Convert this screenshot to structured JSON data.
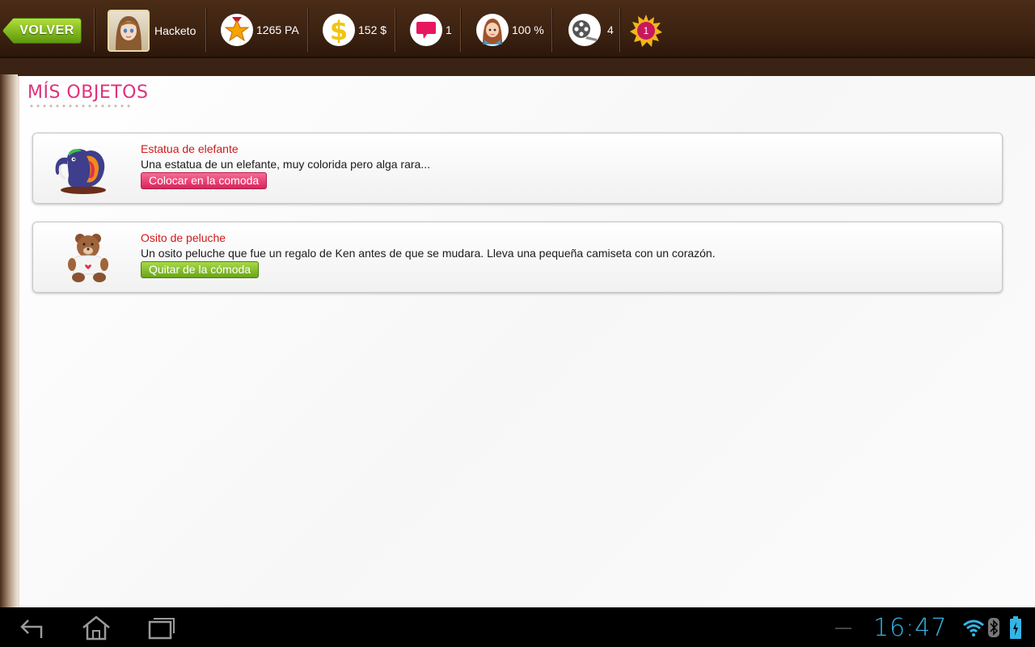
{
  "hud": {
    "back_label": "VOLVER",
    "username": "Hacketo",
    "points": "1265 PA",
    "money": "152 $",
    "messages": "1",
    "mood": "100 %",
    "films": "4",
    "notification_count": "1"
  },
  "page": {
    "title": "MÍS OBJETOS"
  },
  "items": [
    {
      "name": "Estatua de elefante",
      "description": "Una estatua de un elefante, muy colorida pero alga rara...",
      "action": "Colocar en la comoda",
      "action_color": "#d9245b",
      "icon": "elephant-statue-icon"
    },
    {
      "name": "Osito de peluche",
      "description": "Un osito peluche que fue un regalo de Ken antes de que se mudara. Lleva una pequeña camiseta con un corazón.",
      "action": "Quitar de la cómoda",
      "action_color": "#6aa516",
      "icon": "teddy-bear-icon"
    }
  ],
  "status_bar": {
    "time": "16:47"
  },
  "colors": {
    "accent_pink": "#e0317a",
    "item_name_red": "#d01a1a",
    "clock_blue": "#35b5e5",
    "hud_brown": "#3c2211"
  }
}
